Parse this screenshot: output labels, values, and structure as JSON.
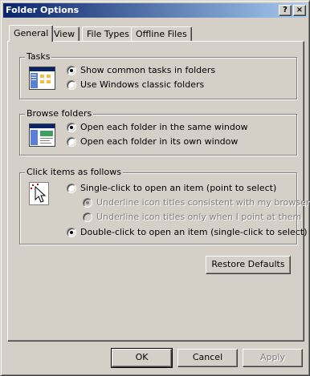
{
  "window": {
    "title": "Folder Options"
  },
  "titlebar": {
    "help_glyph": "?",
    "close_glyph": "×"
  },
  "tabs": [
    {
      "label": "General",
      "active": true
    },
    {
      "label": "View",
      "active": false
    },
    {
      "label": "File Types",
      "active": false
    },
    {
      "label": "Offline Files",
      "active": false
    }
  ],
  "tasks": {
    "label": "Tasks",
    "options": [
      {
        "label": "Show common tasks in folders",
        "checked": true,
        "disabled": false
      },
      {
        "label": "Use Windows classic folders",
        "checked": false,
        "disabled": false
      }
    ]
  },
  "browse": {
    "label": "Browse folders",
    "options": [
      {
        "label": "Open each folder in the same window",
        "checked": true,
        "disabled": false
      },
      {
        "label": "Open each folder in its own window",
        "checked": false,
        "disabled": false
      }
    ]
  },
  "click": {
    "label": "Click items as follows",
    "options": [
      {
        "label": "Single-click to open an item (point to select)",
        "checked": false,
        "disabled": false
      },
      {
        "label": "Underline icon titles consistent with my browser",
        "checked": true,
        "disabled": true
      },
      {
        "label": "Underline icon titles only when I point at them",
        "checked": false,
        "disabled": true
      },
      {
        "label": "Double-click to open an item (single-click to select)",
        "checked": true,
        "disabled": false
      }
    ]
  },
  "buttons": {
    "restore": "Restore Defaults",
    "ok": "OK",
    "cancel": "Cancel",
    "apply": "Apply"
  }
}
